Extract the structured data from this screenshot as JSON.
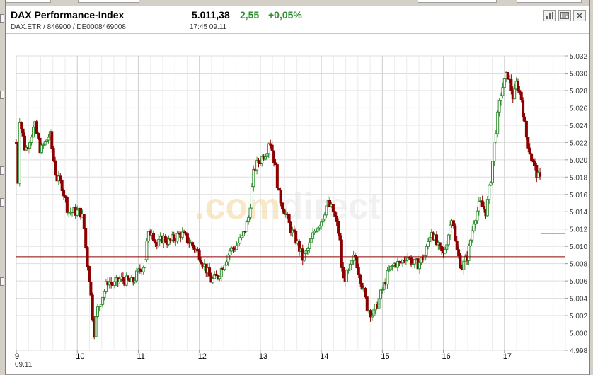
{
  "header": {
    "title": "DAX Performance-Index",
    "subtitle": "DAX.ETR / 846900 / DE0008469008",
    "last_price": "5.011,38",
    "change": "2,55",
    "change_pct": "+0,05%",
    "time": "17:45  09.11"
  },
  "toolbar": {
    "icons": [
      "bar-chart-icon",
      "news-icon",
      "close-icon"
    ]
  },
  "colors": {
    "up": "#2f8f2f",
    "down": "#8b0000",
    "reference_line": "#8b0000",
    "grid": "#dddddd",
    "watermark": "#f5d79a"
  },
  "watermark": {
    "part1": ".com",
    "part2": "direct"
  },
  "chart_data": {
    "type": "candlestick",
    "title": "",
    "xlabel": "",
    "ylabel": "",
    "ylim": [
      4.998,
      5.032
    ],
    "y_ticks": [
      "5.032",
      "5.030",
      "5.028",
      "5.026",
      "5.024",
      "5.022",
      "5.020",
      "5.018",
      "5.016",
      "5.014",
      "5.012",
      "5.010",
      "5.008",
      "5.006",
      "5.004",
      "5.002",
      "5.000",
      "4.998"
    ],
    "x_ticks": [
      "9",
      "10",
      "11",
      "12",
      "13",
      "14",
      "15",
      "16",
      "17"
    ],
    "x_date_label": "09.11",
    "reference_line": 5.0088,
    "grid": true,
    "close_path": [
      [
        9.0,
        5.022
      ],
      [
        9.02,
        5.015
      ],
      [
        9.05,
        5.025
      ],
      [
        9.15,
        5.021
      ],
      [
        9.3,
        5.024
      ],
      [
        9.4,
        5.021
      ],
      [
        9.55,
        5.023
      ],
      [
        9.65,
        5.018
      ],
      [
        9.75,
        5.017
      ],
      [
        9.85,
        5.014
      ],
      [
        9.95,
        5.014
      ],
      [
        10.05,
        5.014
      ],
      [
        10.1,
        5.013
      ],
      [
        10.15,
        5.009
      ],
      [
        10.2,
        5.006
      ],
      [
        10.25,
        5.002
      ],
      [
        10.28,
        5.0
      ],
      [
        10.32,
        5.0025
      ],
      [
        10.4,
        5.004
      ],
      [
        10.5,
        5.006
      ],
      [
        10.6,
        5.0055
      ],
      [
        10.7,
        5.0062
      ],
      [
        10.8,
        5.006
      ],
      [
        10.9,
        5.0058
      ],
      [
        11.0,
        5.007
      ],
      [
        11.1,
        5.008
      ],
      [
        11.15,
        5.011
      ],
      [
        11.22,
        5.012
      ],
      [
        11.3,
        5.01
      ],
      [
        11.4,
        5.011
      ],
      [
        11.5,
        5.0105
      ],
      [
        11.6,
        5.011
      ],
      [
        11.7,
        5.0115
      ],
      [
        11.8,
        5.0108
      ],
      [
        11.9,
        5.01
      ],
      [
        12.0,
        5.009
      ],
      [
        12.1,
        5.0075
      ],
      [
        12.2,
        5.006
      ],
      [
        12.3,
        5.0065
      ],
      [
        12.4,
        5.008
      ],
      [
        12.5,
        5.0095
      ],
      [
        12.6,
        5.01
      ],
      [
        12.7,
        5.011
      ],
      [
        12.8,
        5.013
      ],
      [
        12.9,
        5.019
      ],
      [
        13.0,
        5.02
      ],
      [
        13.1,
        5.021
      ],
      [
        13.15,
        5.0225
      ],
      [
        13.2,
        5.021
      ],
      [
        13.25,
        5.019
      ],
      [
        13.3,
        5.016
      ],
      [
        13.4,
        5.014
      ],
      [
        13.5,
        5.012
      ],
      [
        13.6,
        5.0105
      ],
      [
        13.7,
        5.0085
      ],
      [
        13.8,
        5.01
      ],
      [
        13.9,
        5.012
      ],
      [
        14.0,
        5.013
      ],
      [
        14.1,
        5.015
      ],
      [
        14.2,
        5.014
      ],
      [
        14.3,
        5.011
      ],
      [
        14.35,
        5.006
      ],
      [
        14.45,
        5.007
      ],
      [
        14.55,
        5.009
      ],
      [
        14.65,
        5.006
      ],
      [
        14.75,
        5.003
      ],
      [
        14.85,
        5.002
      ],
      [
        15.0,
        5.005
      ],
      [
        15.1,
        5.007
      ],
      [
        15.2,
        5.008
      ],
      [
        15.3,
        5.008
      ],
      [
        15.4,
        5.009
      ],
      [
        15.5,
        5.008
      ],
      [
        15.6,
        5.008
      ],
      [
        15.7,
        5.009
      ],
      [
        15.8,
        5.012
      ],
      [
        15.9,
        5.01
      ],
      [
        16.0,
        5.009
      ],
      [
        16.1,
        5.012
      ],
      [
        16.15,
        5.014
      ],
      [
        16.2,
        5.01
      ],
      [
        16.3,
        5.0075
      ],
      [
        16.4,
        5.009
      ],
      [
        16.5,
        5.013
      ],
      [
        16.6,
        5.015
      ],
      [
        16.7,
        5.014
      ],
      [
        16.78,
        5.018
      ],
      [
        16.85,
        5.023
      ],
      [
        16.95,
        5.028
      ],
      [
        17.05,
        5.03
      ],
      [
        17.15,
        5.027
      ],
      [
        17.2,
        5.029
      ],
      [
        17.28,
        5.027
      ],
      [
        17.35,
        5.023
      ],
      [
        17.45,
        5.02
      ],
      [
        17.55,
        5.018
      ],
      [
        17.65,
        5.017
      ],
      [
        17.75,
        5.016
      ],
      [
        17.85,
        5.015
      ],
      [
        17.95,
        5.013
      ],
      [
        18.05,
        5.0115
      ],
      [
        18.15,
        5.0115
      ]
    ]
  }
}
